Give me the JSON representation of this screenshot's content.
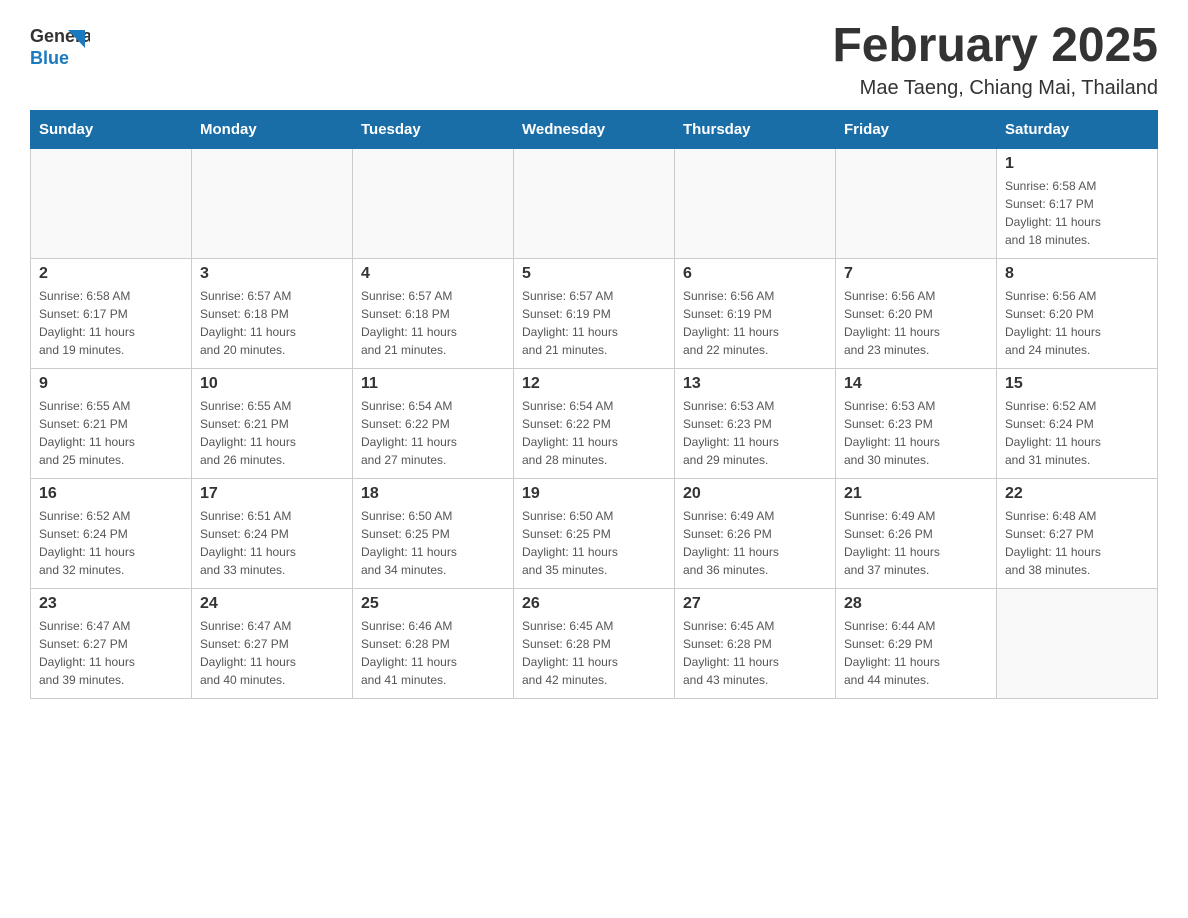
{
  "header": {
    "logo": {
      "general": "General",
      "blue": "Blue"
    },
    "title": "February 2025",
    "subtitle": "Mae Taeng, Chiang Mai, Thailand"
  },
  "calendar": {
    "days_of_week": [
      "Sunday",
      "Monday",
      "Tuesday",
      "Wednesday",
      "Thursday",
      "Friday",
      "Saturday"
    ],
    "weeks": [
      [
        {
          "day": "",
          "info": ""
        },
        {
          "day": "",
          "info": ""
        },
        {
          "day": "",
          "info": ""
        },
        {
          "day": "",
          "info": ""
        },
        {
          "day": "",
          "info": ""
        },
        {
          "day": "",
          "info": ""
        },
        {
          "day": "1",
          "info": "Sunrise: 6:58 AM\nSunset: 6:17 PM\nDaylight: 11 hours\nand 18 minutes."
        }
      ],
      [
        {
          "day": "2",
          "info": "Sunrise: 6:58 AM\nSunset: 6:17 PM\nDaylight: 11 hours\nand 19 minutes."
        },
        {
          "day": "3",
          "info": "Sunrise: 6:57 AM\nSunset: 6:18 PM\nDaylight: 11 hours\nand 20 minutes."
        },
        {
          "day": "4",
          "info": "Sunrise: 6:57 AM\nSunset: 6:18 PM\nDaylight: 11 hours\nand 21 minutes."
        },
        {
          "day": "5",
          "info": "Sunrise: 6:57 AM\nSunset: 6:19 PM\nDaylight: 11 hours\nand 21 minutes."
        },
        {
          "day": "6",
          "info": "Sunrise: 6:56 AM\nSunset: 6:19 PM\nDaylight: 11 hours\nand 22 minutes."
        },
        {
          "day": "7",
          "info": "Sunrise: 6:56 AM\nSunset: 6:20 PM\nDaylight: 11 hours\nand 23 minutes."
        },
        {
          "day": "8",
          "info": "Sunrise: 6:56 AM\nSunset: 6:20 PM\nDaylight: 11 hours\nand 24 minutes."
        }
      ],
      [
        {
          "day": "9",
          "info": "Sunrise: 6:55 AM\nSunset: 6:21 PM\nDaylight: 11 hours\nand 25 minutes."
        },
        {
          "day": "10",
          "info": "Sunrise: 6:55 AM\nSunset: 6:21 PM\nDaylight: 11 hours\nand 26 minutes."
        },
        {
          "day": "11",
          "info": "Sunrise: 6:54 AM\nSunset: 6:22 PM\nDaylight: 11 hours\nand 27 minutes."
        },
        {
          "day": "12",
          "info": "Sunrise: 6:54 AM\nSunset: 6:22 PM\nDaylight: 11 hours\nand 28 minutes."
        },
        {
          "day": "13",
          "info": "Sunrise: 6:53 AM\nSunset: 6:23 PM\nDaylight: 11 hours\nand 29 minutes."
        },
        {
          "day": "14",
          "info": "Sunrise: 6:53 AM\nSunset: 6:23 PM\nDaylight: 11 hours\nand 30 minutes."
        },
        {
          "day": "15",
          "info": "Sunrise: 6:52 AM\nSunset: 6:24 PM\nDaylight: 11 hours\nand 31 minutes."
        }
      ],
      [
        {
          "day": "16",
          "info": "Sunrise: 6:52 AM\nSunset: 6:24 PM\nDaylight: 11 hours\nand 32 minutes."
        },
        {
          "day": "17",
          "info": "Sunrise: 6:51 AM\nSunset: 6:24 PM\nDaylight: 11 hours\nand 33 minutes."
        },
        {
          "day": "18",
          "info": "Sunrise: 6:50 AM\nSunset: 6:25 PM\nDaylight: 11 hours\nand 34 minutes."
        },
        {
          "day": "19",
          "info": "Sunrise: 6:50 AM\nSunset: 6:25 PM\nDaylight: 11 hours\nand 35 minutes."
        },
        {
          "day": "20",
          "info": "Sunrise: 6:49 AM\nSunset: 6:26 PM\nDaylight: 11 hours\nand 36 minutes."
        },
        {
          "day": "21",
          "info": "Sunrise: 6:49 AM\nSunset: 6:26 PM\nDaylight: 11 hours\nand 37 minutes."
        },
        {
          "day": "22",
          "info": "Sunrise: 6:48 AM\nSunset: 6:27 PM\nDaylight: 11 hours\nand 38 minutes."
        }
      ],
      [
        {
          "day": "23",
          "info": "Sunrise: 6:47 AM\nSunset: 6:27 PM\nDaylight: 11 hours\nand 39 minutes."
        },
        {
          "day": "24",
          "info": "Sunrise: 6:47 AM\nSunset: 6:27 PM\nDaylight: 11 hours\nand 40 minutes."
        },
        {
          "day": "25",
          "info": "Sunrise: 6:46 AM\nSunset: 6:28 PM\nDaylight: 11 hours\nand 41 minutes."
        },
        {
          "day": "26",
          "info": "Sunrise: 6:45 AM\nSunset: 6:28 PM\nDaylight: 11 hours\nand 42 minutes."
        },
        {
          "day": "27",
          "info": "Sunrise: 6:45 AM\nSunset: 6:28 PM\nDaylight: 11 hours\nand 43 minutes."
        },
        {
          "day": "28",
          "info": "Sunrise: 6:44 AM\nSunset: 6:29 PM\nDaylight: 11 hours\nand 44 minutes."
        },
        {
          "day": "",
          "info": ""
        }
      ]
    ]
  }
}
